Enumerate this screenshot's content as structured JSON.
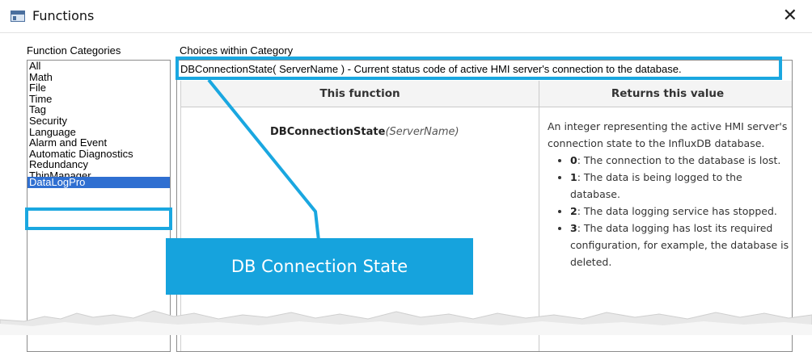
{
  "window": {
    "title": "Functions",
    "close_glyph": "✕"
  },
  "labels": {
    "function_categories": "Function Categories",
    "choices_within_category": "Choices within Category"
  },
  "categories": [
    {
      "label": "All"
    },
    {
      "label": "Math"
    },
    {
      "label": "File"
    },
    {
      "label": "Time"
    },
    {
      "label": "Tag"
    },
    {
      "label": "Security"
    },
    {
      "label": "Language"
    },
    {
      "label": "Alarm and Event"
    },
    {
      "label": "Automatic Diagnostics"
    },
    {
      "label": "Redundancy"
    },
    {
      "label": "ThinManager"
    },
    {
      "label": "DataLogPro",
      "selected": true
    }
  ],
  "choice": "DBConnectionState( ServerName ) - Current status code of active HMI server's connection to the database.",
  "doc_table": {
    "col1_header": "This function",
    "col2_header": "Returns this value",
    "function_name": "DBConnectionState",
    "function_param": "(ServerName)",
    "description": "An integer representing the active HMI server's connection state to the InfluxDB database.",
    "values": [
      {
        "code": "0",
        "text": ": The connection to the database is lost."
      },
      {
        "code": "1",
        "text": ": The data is being logged to the database."
      },
      {
        "code": "2",
        "text": ": The data logging service has stopped."
      },
      {
        "code": "3",
        "text": ": The data logging has lost its required configuration, for example, the database is deleted."
      }
    ]
  },
  "callout": {
    "text": "DB Connection State"
  },
  "colors": {
    "highlight": "#1aa7e0",
    "callout_bg": "#16a3dd",
    "selection": "#2f6fd1"
  }
}
